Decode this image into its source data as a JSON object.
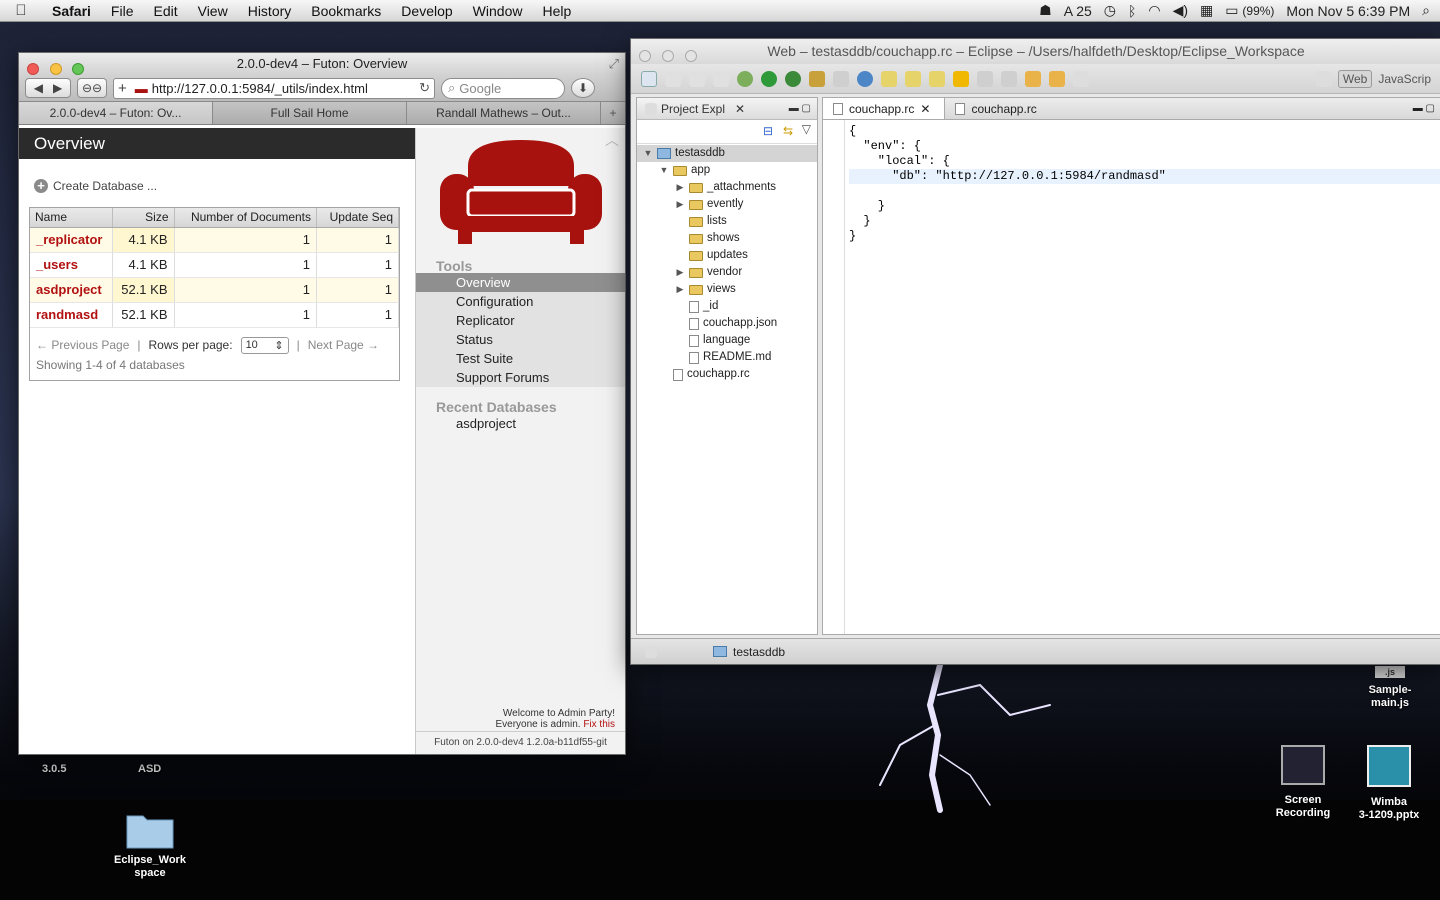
{
  "menubar": {
    "app_name": "Safari",
    "items": [
      "File",
      "Edit",
      "View",
      "History",
      "Bookmarks",
      "Develop",
      "Window",
      "Help"
    ],
    "status": {
      "adobe_count": "25",
      "battery": "(99%)",
      "datetime": "Mon Nov 5  6:39 PM"
    }
  },
  "safari": {
    "title": "2.0.0-dev4 – Futon: Overview",
    "url": "http://127.0.0.1:5984/_utils/index.html",
    "search_placeholder": "Google",
    "tabs": [
      "2.0.0-dev4 – Futon: Ov...",
      "Full Sail Home",
      "Randall Mathews – Out..."
    ]
  },
  "futon": {
    "header": "Overview",
    "create_db": "Create Database ...",
    "columns": [
      "Name",
      "Size",
      "Number of Documents",
      "Update Seq"
    ],
    "rows": [
      {
        "name": "_replicator",
        "size": "4.1 KB",
        "docs": "1",
        "seq": "1"
      },
      {
        "name": "_users",
        "size": "4.1 KB",
        "docs": "1",
        "seq": "1"
      },
      {
        "name": "asdproject",
        "size": "52.1 KB",
        "docs": "1",
        "seq": "1"
      },
      {
        "name": "randmasd",
        "size": "52.1 KB",
        "docs": "1",
        "seq": "1"
      }
    ],
    "prev_page": "← Previous Page",
    "rows_per_page_label": "Rows per page:",
    "rows_per_page_value": "10",
    "next_page": "Next Page →",
    "showing": "Showing 1-4 of 4 databases",
    "tools_heading": "Tools",
    "tools": [
      "Overview",
      "Configuration",
      "Replicator",
      "Status",
      "Test Suite",
      "Support Forums"
    ],
    "recent_heading": "Recent Databases",
    "recent": [
      "asdproject"
    ],
    "welcome_line1": "Welcome to Admin Party!",
    "welcome_line2": "Everyone is admin.",
    "fix_link": "Fix this",
    "version": "Futon on 2.0.0-dev4 1.2.0a-b11df55-git"
  },
  "eclipse": {
    "title": "Web – testasddb/couchapp.rc – Eclipse – /Users/halfdeth/Desktop/Eclipse_Workspace",
    "perspective_web": "Web",
    "perspective_js": "JavaScrip",
    "project_explorer_tab": "Project Expl",
    "tree": [
      {
        "label": "testasddb",
        "depth": 0,
        "type": "project",
        "arrow": "▼"
      },
      {
        "label": "app",
        "depth": 1,
        "type": "folder",
        "arrow": "▼"
      },
      {
        "label": "_attachments",
        "depth": 2,
        "type": "folder",
        "arrow": "▶"
      },
      {
        "label": "evently",
        "depth": 2,
        "type": "folder",
        "arrow": "▶"
      },
      {
        "label": "lists",
        "depth": 2,
        "type": "folder",
        "arrow": ""
      },
      {
        "label": "shows",
        "depth": 2,
        "type": "folder",
        "arrow": ""
      },
      {
        "label": "updates",
        "depth": 2,
        "type": "folder",
        "arrow": ""
      },
      {
        "label": "vendor",
        "depth": 2,
        "type": "folder",
        "arrow": "▶"
      },
      {
        "label": "views",
        "depth": 2,
        "type": "folder",
        "arrow": "▶"
      },
      {
        "label": "_id",
        "depth": 2,
        "type": "file",
        "arrow": ""
      },
      {
        "label": "couchapp.json",
        "depth": 2,
        "type": "file",
        "arrow": ""
      },
      {
        "label": "language",
        "depth": 2,
        "type": "file",
        "arrow": ""
      },
      {
        "label": "README.md",
        "depth": 2,
        "type": "file",
        "arrow": ""
      },
      {
        "label": "couchapp.rc",
        "depth": 1,
        "type": "file",
        "arrow": ""
      }
    ],
    "editor_tabs": [
      "couchapp.rc",
      "couchapp.rc"
    ],
    "code_lines": [
      "{",
      "  \"env\": {",
      "    \"local\": {",
      "      \"db\": \"http://127.0.0.1:5984/randmasd\"",
      "",
      "    }",
      "  }",
      "}"
    ],
    "status_project": "testasddb"
  },
  "desktop": {
    "labels": [
      "3.0.5",
      "ASD"
    ],
    "icons": [
      {
        "name": "Eclipse_Work\nspace"
      },
      {
        "name": "Screen\nRecording"
      },
      {
        "name": "Wimba\n3-1209.pptx"
      },
      {
        "name": "Sample-\nmain.js"
      }
    ]
  }
}
